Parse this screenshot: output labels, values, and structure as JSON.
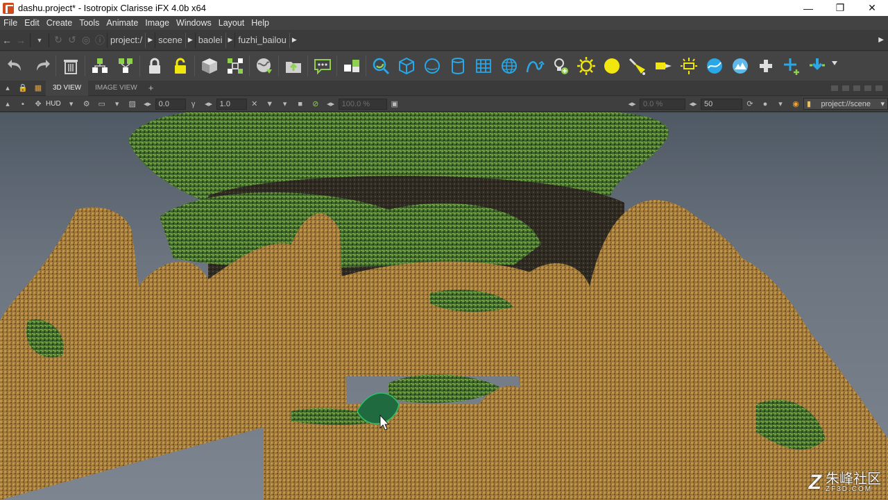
{
  "window": {
    "title": "dashu.project* - Isotropix Clarisse iFX 4.0b x64",
    "minimize": "—",
    "maximize": "❐",
    "close": "✕"
  },
  "menu": [
    "File",
    "Edit",
    "Create",
    "Tools",
    "Animate",
    "Image",
    "Windows",
    "Layout",
    "Help"
  ],
  "breadcrumb": [
    "project:/",
    "scene",
    "baolei",
    "fuzhi_bailou"
  ],
  "tabs": {
    "view3d": "3D VIEW",
    "image_view": "IMAGE VIEW",
    "add": "+"
  },
  "viewport_toolbar": {
    "hud": "HUD",
    "field_a": "0.0",
    "field_b": "1.0",
    "field_percent": "100.0 %",
    "field_percent2": "0.0 %",
    "field_samples": "50",
    "context_path": "project://scene"
  },
  "watermark": {
    "logo": "Z",
    "cn": "朱峰社区",
    "en": "ZF3D.COM"
  },
  "colors": {
    "accent_blue": "#2aa7e6",
    "accent_green": "#8fd14f",
    "accent_yellow": "#f2e60f",
    "stone": "#a9823f",
    "foliage": "#4e7a3a"
  }
}
